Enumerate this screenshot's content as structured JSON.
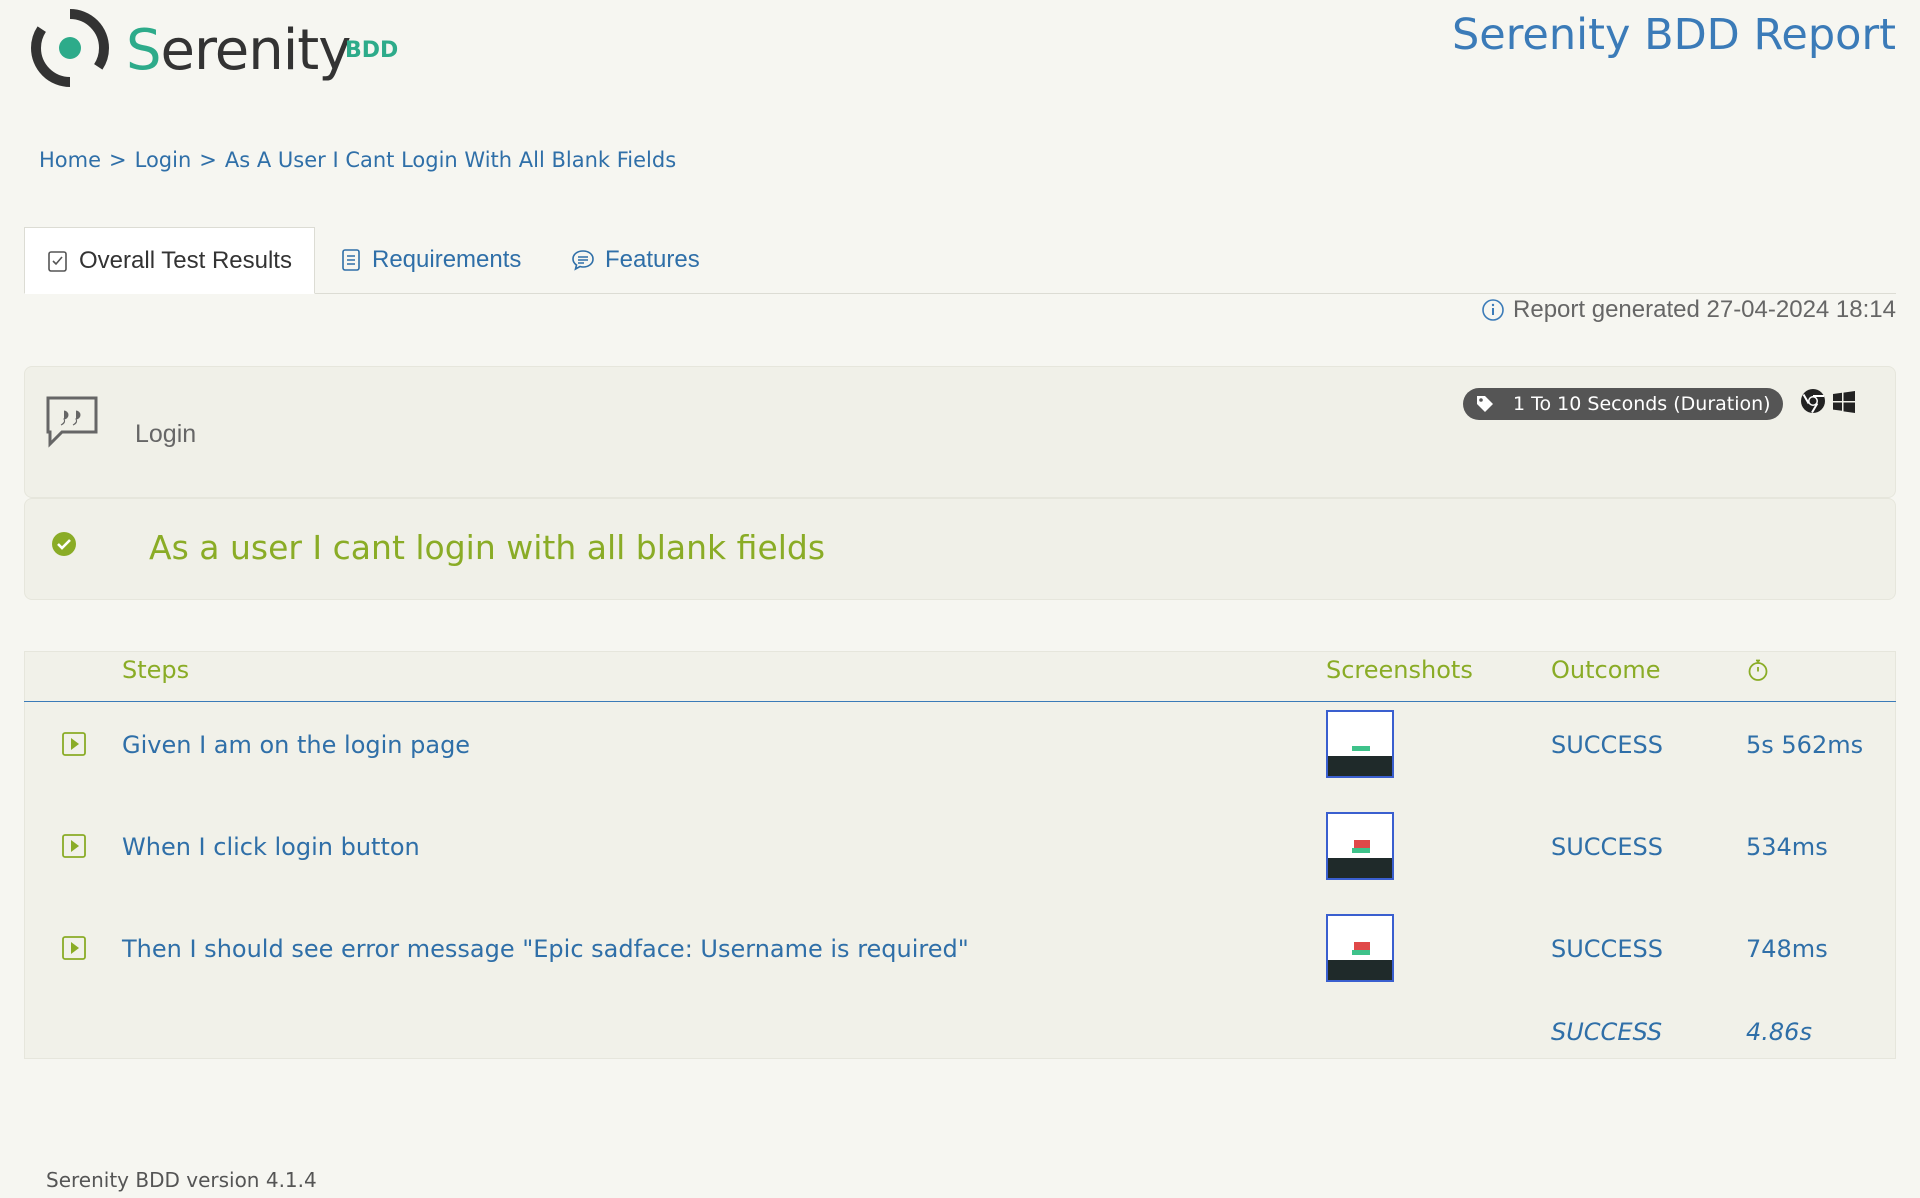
{
  "header": {
    "logo_text_prefix": "S",
    "logo_text": "erenity",
    "logo_suffix": "BDD",
    "title": "Serenity BDD Report"
  },
  "breadcrumb": [
    "Home",
    "Login",
    "As A User I Cant Login With All Blank Fields"
  ],
  "tabs": [
    {
      "label": "Overall Test Results",
      "icon": "checklist-icon",
      "active": true
    },
    {
      "label": "Requirements",
      "icon": "document-list-icon",
      "active": false
    },
    {
      "label": "Features",
      "icon": "speech-bubble-icon",
      "active": false
    }
  ],
  "report_generated": "Report generated 27-04-2024 18:14",
  "feature": {
    "name": "Login",
    "tag": "1 To 10 Seconds (Duration)"
  },
  "scenario": {
    "title": "As a user I cant login with all blank fields",
    "status_color": "#8aac26"
  },
  "table": {
    "headers": {
      "steps": "Steps",
      "screenshots": "Screenshots",
      "outcome": "Outcome"
    },
    "rows": [
      {
        "step": "Given I am on the login page",
        "outcome": "SUCCESS",
        "duration": "5s 562ms"
      },
      {
        "step": "When I click login button",
        "outcome": "SUCCESS",
        "duration": "534ms"
      },
      {
        "step": "Then I should see error message \"Epic sadface: Username is required\"",
        "outcome": "SUCCESS",
        "duration": "748ms"
      }
    ],
    "total": {
      "outcome": "SUCCESS",
      "duration": "4.86s"
    }
  },
  "footer": "Serenity BDD version 4.1.4",
  "colors": {
    "accent_blue": "#3b7bb8",
    "accent_green": "#8aac26",
    "logo_green": "#2dab8a"
  }
}
